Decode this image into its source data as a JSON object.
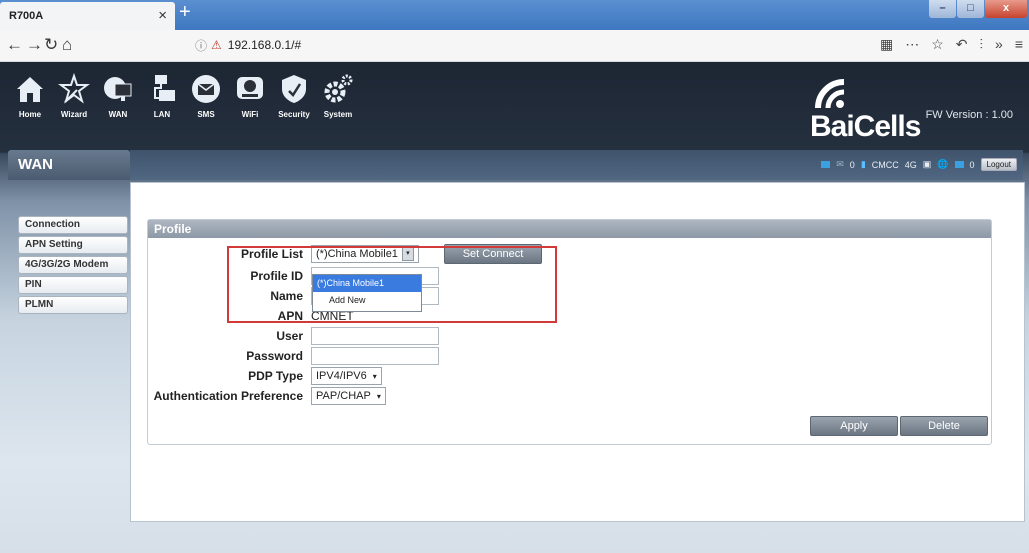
{
  "browser": {
    "tab_title": "R700A",
    "tab_close": "×",
    "new_tab": "+",
    "url": "192.168.0.1/#",
    "window_buttons": [
      "–",
      "□",
      "x"
    ]
  },
  "topnav": [
    {
      "label": "Home",
      "icon": "home-icon"
    },
    {
      "label": "Wizard",
      "icon": "wizard-icon"
    },
    {
      "label": "WAN",
      "icon": "wan-icon"
    },
    {
      "label": "LAN",
      "icon": "lan-icon"
    },
    {
      "label": "SMS",
      "icon": "sms-icon"
    },
    {
      "label": "WiFi",
      "icon": "wifi-icon"
    },
    {
      "label": "Security",
      "icon": "security-icon"
    },
    {
      "label": "System",
      "icon": "system-icon"
    }
  ],
  "brand": {
    "logo": "BaiCells",
    "fw_version": "FW Version : 1.00"
  },
  "section_title": "WAN",
  "status": {
    "sms_count": "0",
    "carrier": "CMCC",
    "network": "4G",
    "device_count": "0",
    "logout_label": "Logout"
  },
  "sidebar": [
    "Connection",
    "APN Setting",
    "4G/3G/2G Modem",
    "PIN",
    "PLMN"
  ],
  "profile": {
    "title": "Profile",
    "labels": {
      "profile_list": "Profile List",
      "profile_id": "Profile ID",
      "name": "Name",
      "apn": "APN",
      "user": "User",
      "password": "Password",
      "pdp_type": "PDP Type",
      "auth_pref": "Authentication Preference"
    },
    "values": {
      "profile_list": "(*)China Mobile1",
      "apn": "CMNET",
      "pdp_type": "IPV4/IPV6",
      "auth_pref": "PAP/CHAP"
    },
    "dropdown_options": [
      "(*)China Mobile1",
      "Add New"
    ],
    "set_connect_label": "Set Connect",
    "apply_label": "Apply",
    "delete_label": "Delete"
  },
  "colors": {
    "highlight": "#d23a3a",
    "selected_option": "#3a7be0"
  }
}
